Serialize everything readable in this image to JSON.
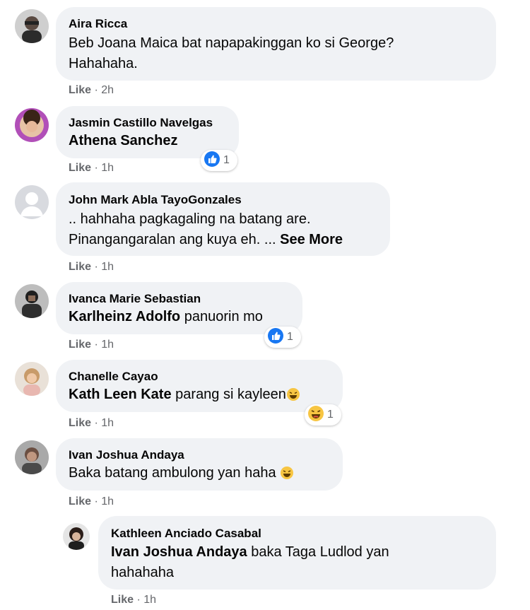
{
  "comments": [
    {
      "author": "Aira Ricca",
      "line1": "Beb Joana Maica bat napapakinggan ko si George?",
      "line2": "Hahahaha.",
      "like": "Like",
      "time": "2h"
    },
    {
      "author": "Jasmin Castillo Navelgas",
      "tag": "Athena Sanchez",
      "like": "Like",
      "time": "1h",
      "reaction": {
        "icon": "like-reaction-icon",
        "count": "1"
      }
    },
    {
      "author": "John Mark Abla TayoGonzales",
      "line1": ".. hahhaha pagkagaling na batang are.",
      "line2": "Pinangangaralan ang kuya eh. ...",
      "see_more": "See More",
      "like": "Like",
      "time": "1h"
    },
    {
      "author": "Ivanca Marie Sebastian",
      "tag": "Karlheinz Adolfo",
      "text": "panuorin mo",
      "like": "Like",
      "time": "1h",
      "reaction": {
        "icon": "like-reaction-icon",
        "count": "1"
      }
    },
    {
      "author": "Chanelle Cayao",
      "tag": "Kath Leen Kate",
      "text": "parang si kayleen",
      "emoji": "laughing-emoji-icon",
      "like": "Like",
      "time": "1h",
      "reaction": {
        "icon": "haha-reaction-icon",
        "count": "1"
      }
    },
    {
      "author": "Ivan Joshua Andaya",
      "text": "Baka batang ambulong yan haha",
      "emoji": "laughing-emoji-icon",
      "like": "Like",
      "time": "1h"
    },
    {
      "author": "Kathleen Anciado Casabal",
      "tag": "Ivan Joshua Andaya",
      "text": "baka Taga Ludlod yan",
      "line2": "hahahaha",
      "like": "Like",
      "time": "1h",
      "is_reply": true
    }
  ],
  "meta_separator": " · ",
  "colors": {
    "bubble": "#f0f2f5",
    "meta": "#65676b",
    "like_blue": "#1877f2",
    "haha_yellow": "#f7c542"
  }
}
